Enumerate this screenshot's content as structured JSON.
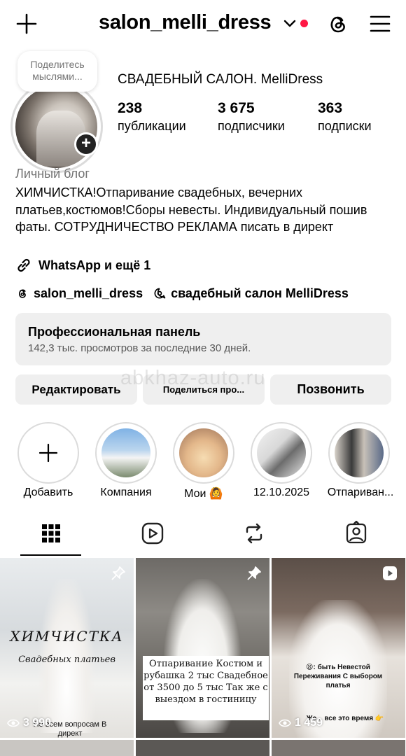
{
  "header": {
    "username": "salon_melli_dress",
    "accent_dot_color": "#ff1744",
    "icons": [
      "plus-icon",
      "chevron-down-icon",
      "threads-icon",
      "menu-icon"
    ]
  },
  "profile": {
    "note_bubble": "Поделитесь мыслями...",
    "display_name": "СВАДЕБНЫЙ САЛОН. MelliDress",
    "stats": [
      {
        "value": "238",
        "label": "публикации"
      },
      {
        "value": "3 675",
        "label": "подписчики"
      },
      {
        "value": "363",
        "label": "подписки"
      }
    ],
    "category": "Личный блог",
    "bio": "ХИМЧИСТКА!Отпаривание свадебных, вечерних платьев,костюмов!Сборы невесты. Индивидуальный пошив фаты. СОТРУДНИЧЕСТВО РЕКЛАМА писать в директ",
    "link_text": "WhatsApp и ещё 1",
    "threads_handle": "salon_melli_dress",
    "threads_channel": "свадебный салон MelliDress"
  },
  "pro_panel": {
    "title": "Профессиональная панель",
    "subtitle": "142,3 тыс. просмотров за последние 30 дней."
  },
  "buttons": {
    "edit": "Редактировать",
    "share": "Поделиться про...",
    "call": "Позвонить"
  },
  "watermark": "abkhaz-auto.ru",
  "highlights": [
    {
      "label": "Добавить"
    },
    {
      "label": "Компания"
    },
    {
      "label": "Мои 🙆"
    },
    {
      "label": "12.10.2025"
    },
    {
      "label": "Отпариван..."
    }
  ],
  "tabs": [
    "grid-icon",
    "reels-icon",
    "repost-icon",
    "tagged-icon"
  ],
  "posts": [
    {
      "views": "3 990",
      "overlay_title": "ХИМЧИСТКА",
      "overlay_sub": "Свадебных платьев",
      "overlay_footer": "По всем вопросам В директ",
      "corner": "pin-icon"
    },
    {
      "views": "",
      "overlay_text": "Отпаривание Костюм и рубашка 2 тыс Свадебное от 3500 до 5 тыс Так же с выездом в гостиницу",
      "corner": "pin-icon"
    },
    {
      "views": "1 459",
      "overlay_text": "😫: быть Невестой Переживания С выбором платья",
      "overlay_footer": "Же... все это время 👉",
      "corner": "reel-icon"
    }
  ]
}
